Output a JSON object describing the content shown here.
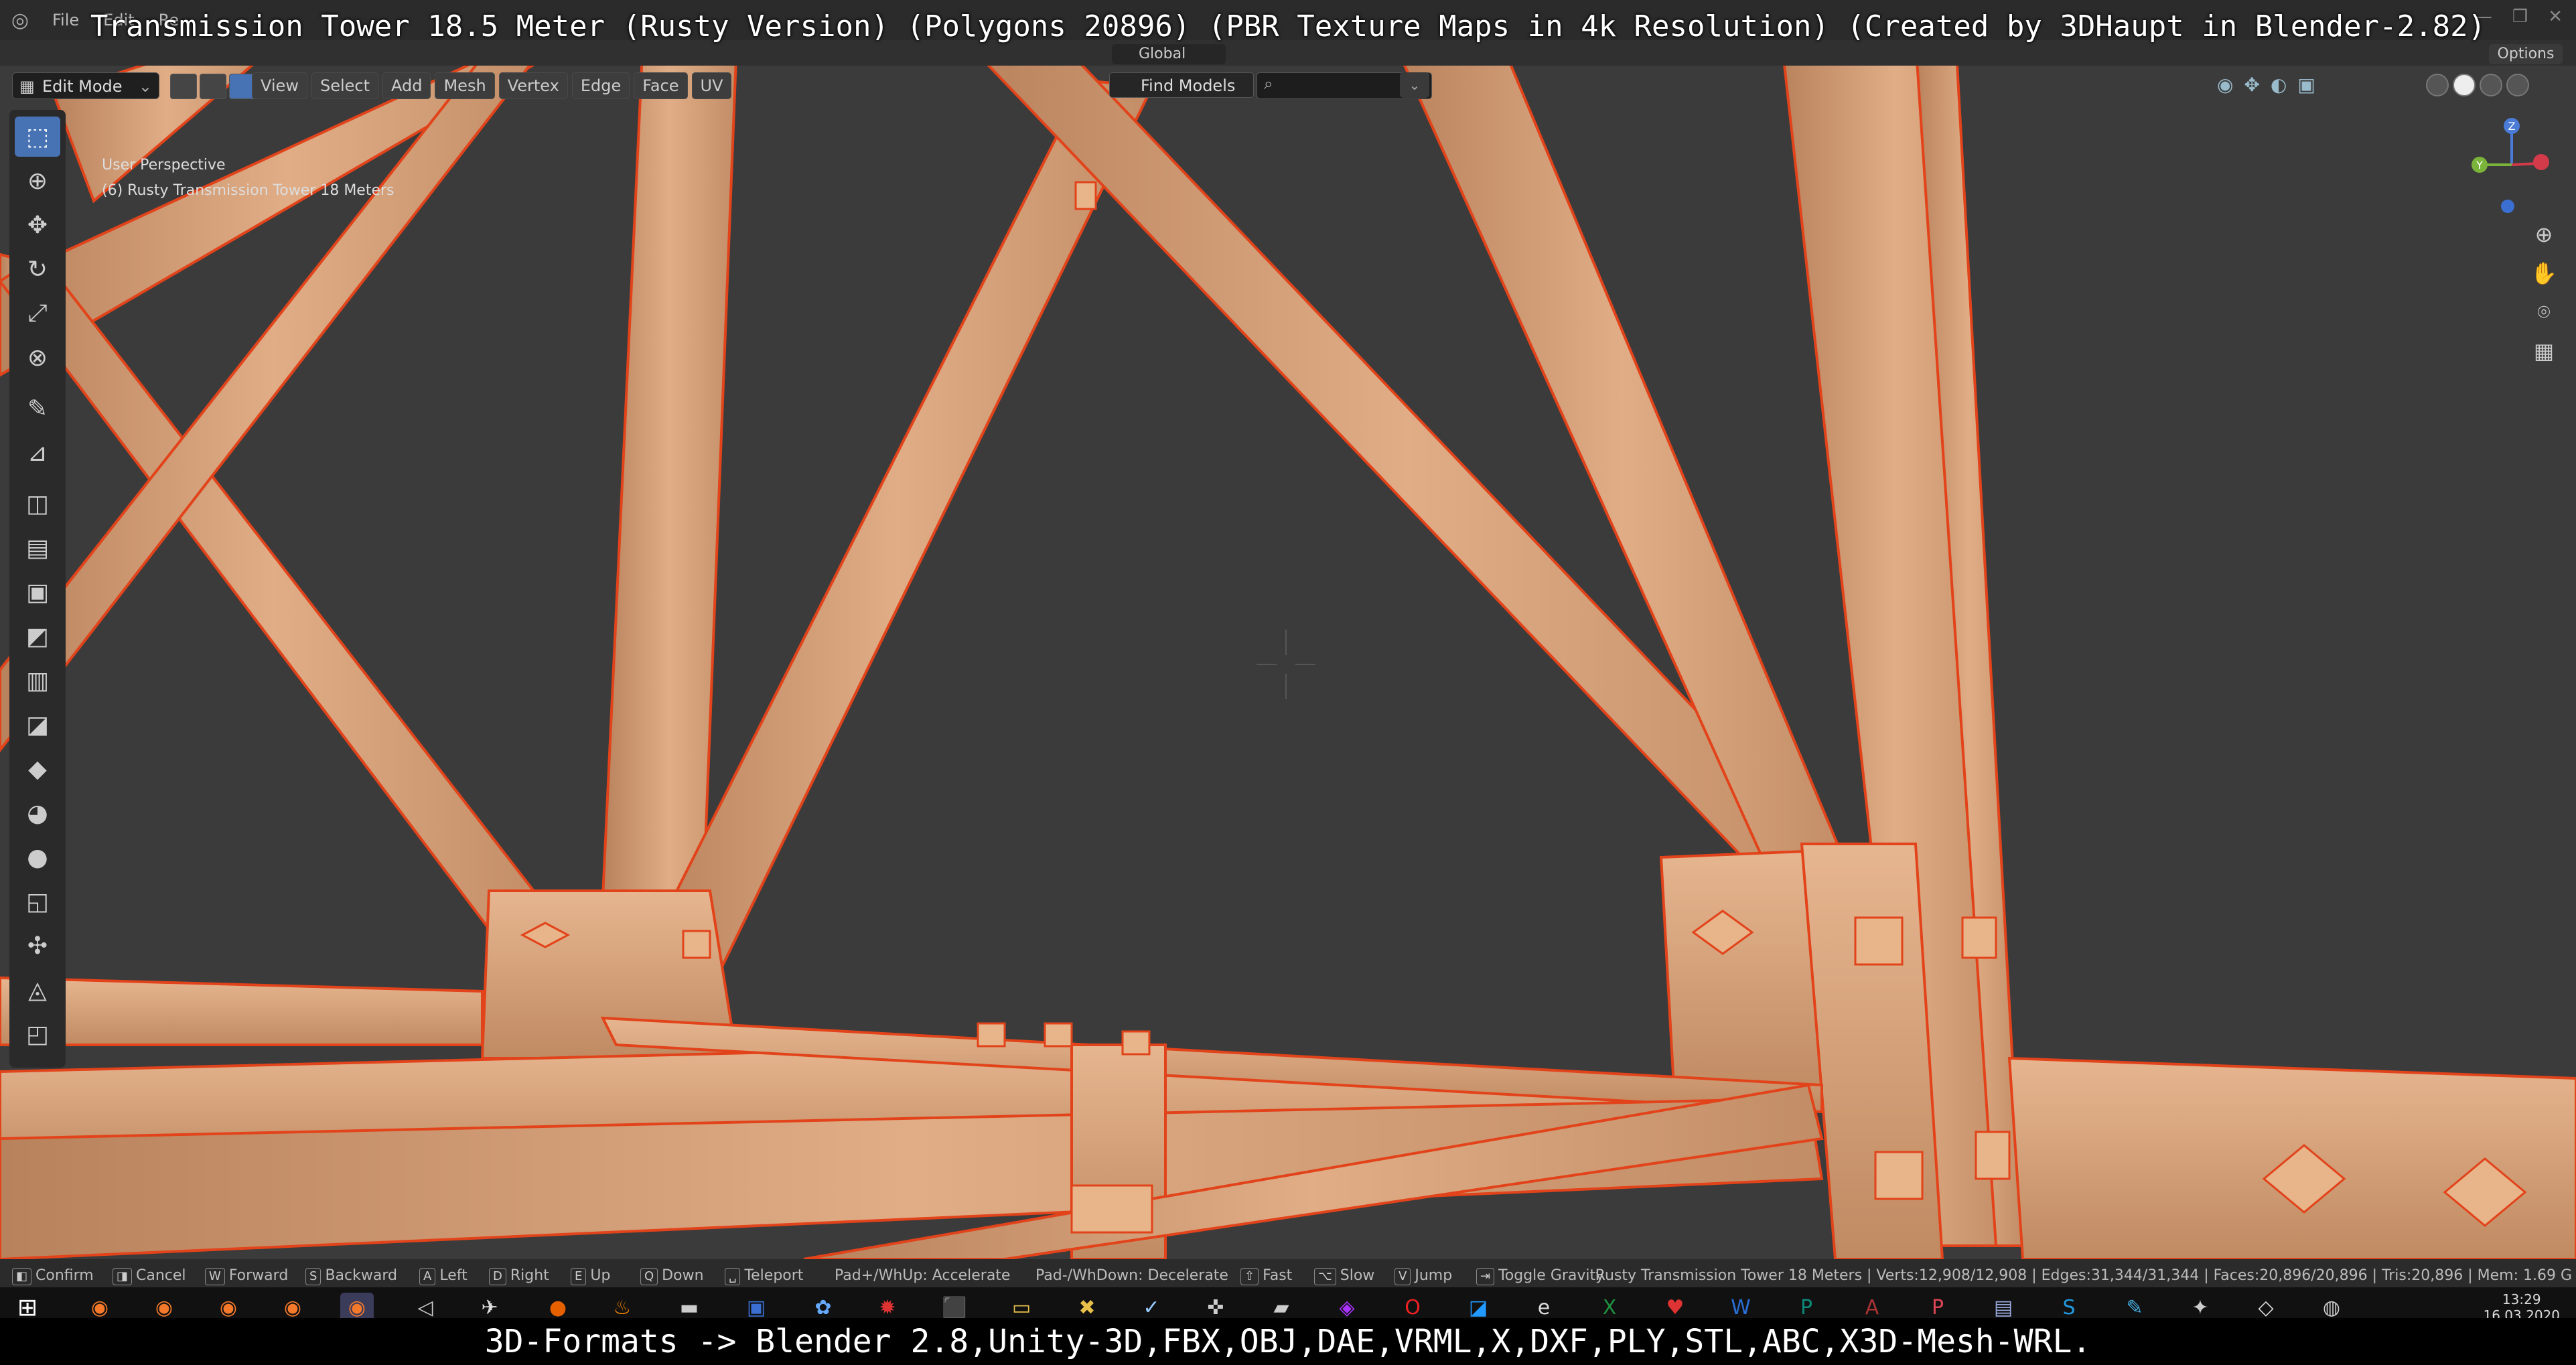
{
  "overlay": {
    "title": "Transmission Tower 18.5 Meter (Rusty Version) (Polygons 20896) (PBR Texture Maps in 4k Resolution) (Created by 3DHaupt in Blender-2.82)",
    "footer": "3D-Formats -> Blender 2.8,Unity-3D,FBX,OBJ,DAE,VRML,X,DXF,PLY,STL,ABC,X3D-Mesh-WRL."
  },
  "menubar": {
    "items": [
      "File",
      "Edit",
      "Re"
    ]
  },
  "header": {
    "mode": "Edit Mode",
    "menus": [
      "View",
      "Select",
      "Add",
      "Mesh",
      "Vertex",
      "Edge",
      "Face",
      "UV"
    ],
    "orientation": "Global",
    "find_models": "Find Models",
    "options": "Options"
  },
  "viewport": {
    "perspective": "User Perspective",
    "object": "(6) Rusty Transmission Tower 18 Meters"
  },
  "toolbar": {
    "tools": [
      "select-box",
      "cursor",
      "move",
      "rotate",
      "scale",
      "transform",
      "annotate",
      "measure",
      "add-cube",
      "extrude",
      "inset",
      "bevel",
      "loop-cut",
      "knife",
      "poly-build",
      "spin",
      "smooth",
      "shrink",
      "shear",
      "rip",
      "edge-slide"
    ]
  },
  "gizmo": {
    "z": "Z",
    "y": "Y"
  },
  "status": {
    "confirm": "Confirm",
    "cancel": "Cancel",
    "w": "W",
    "forward": "Forward",
    "s": "S",
    "backward": "Backward",
    "a": "A",
    "left": "Left",
    "d": "D",
    "right": "Right",
    "e": "E",
    "up": "Up",
    "q": "Q",
    "down": "Down",
    "teleport": "Teleport",
    "accelerate": "Pad+/WhUp: Accelerate",
    "decelerate": "Pad-/WhDown: Decelerate",
    "fast": "Fast",
    "slow": "Slow",
    "v": "V",
    "jump": "Jump",
    "gravity": "Toggle Gravity",
    "stats": "Rusty Transmission Tower 18 Meters | Verts:12,908/12,908 | Edges:31,344/31,344 | Faces:20,896/20,896 | Tris:20,896 | Mem: 1.69 G"
  },
  "taskbar": {
    "time": "13:29",
    "date": "16.03.2020"
  },
  "colors": {
    "steel": "#d9a37a",
    "edge": "#e2431a",
    "bg": "#3a3a3a"
  }
}
